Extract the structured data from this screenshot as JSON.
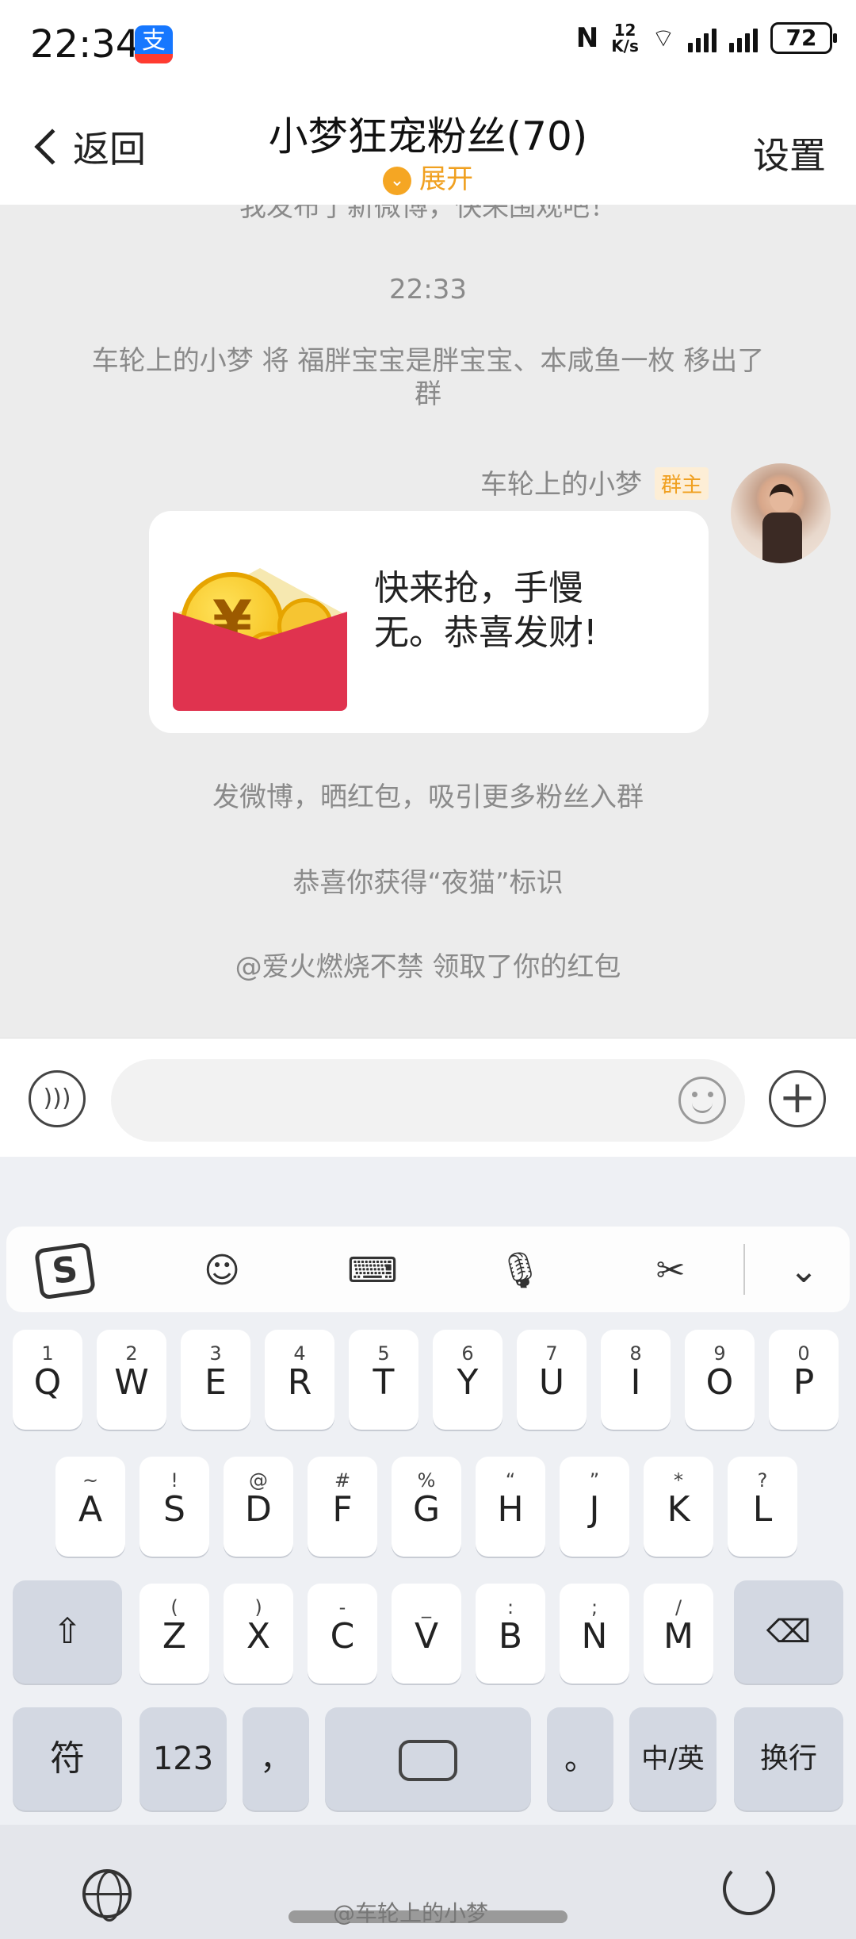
{
  "status": {
    "time": "22:34",
    "net_speed": "12\nK/s",
    "net1": "6",
    "net2": "5A",
    "net3": "5A",
    "battery": "72"
  },
  "header": {
    "back_label": "返回",
    "title": "小梦狂宠粉丝(70)",
    "expand_label": "展开",
    "settings_label": "设置"
  },
  "chat": {
    "cut_message": "我发布了新微博，快来围观吧！",
    "timestamp": "22:33",
    "removed_notice": "车轮上的小梦 将 福胖宝宝是胖宝宝、本咸鱼一枚 移出了群",
    "sender_name": "车轮上的小梦",
    "owner_badge": "群主",
    "red_packet_text": "快来抢，手慢无。恭喜发财!",
    "red_packet_symbol": "¥",
    "notice_weibo": "发微博，晒红包，吸引更多粉丝入群",
    "notice_badge": "恭喜你获得“夜猫”标识",
    "notice_received": "@爱火燃烧不禁 领取了你的红包"
  },
  "keyboard": {
    "row1": [
      {
        "sup": "1",
        "k": "Q"
      },
      {
        "sup": "2",
        "k": "W"
      },
      {
        "sup": "3",
        "k": "E"
      },
      {
        "sup": "4",
        "k": "R"
      },
      {
        "sup": "5",
        "k": "T"
      },
      {
        "sup": "6",
        "k": "Y"
      },
      {
        "sup": "7",
        "k": "U"
      },
      {
        "sup": "8",
        "k": "I"
      },
      {
        "sup": "9",
        "k": "O"
      },
      {
        "sup": "0",
        "k": "P"
      }
    ],
    "row2": [
      {
        "sup": "~",
        "k": "A"
      },
      {
        "sup": "!",
        "k": "S"
      },
      {
        "sup": "@",
        "k": "D"
      },
      {
        "sup": "#",
        "k": "F"
      },
      {
        "sup": "%",
        "k": "G"
      },
      {
        "sup": "“",
        "k": "H"
      },
      {
        "sup": "”",
        "k": "J"
      },
      {
        "sup": "*",
        "k": "K"
      },
      {
        "sup": "?",
        "k": "L"
      }
    ],
    "row3": [
      {
        "sup": "(",
        "k": "Z"
      },
      {
        "sup": ")",
        "k": "X"
      },
      {
        "sup": "-",
        "k": "C"
      },
      {
        "sup": "_",
        "k": "V"
      },
      {
        "sup": ":",
        "k": "B"
      },
      {
        "sup": ";",
        "k": "N"
      },
      {
        "sup": "/",
        "k": "M"
      }
    ],
    "symbols_label": "符",
    "numbers_label": "123",
    "comma_label": "，",
    "period_label": "。",
    "lang_label": "中/英",
    "enter_label": "换行",
    "toolbar_icons": [
      "sogou-icon",
      "emoji-icon",
      "keyboard-icon",
      "microphone-icon",
      "scissors-icon",
      "collapse-icon"
    ]
  },
  "watermark": "@车轮上的小梦"
}
